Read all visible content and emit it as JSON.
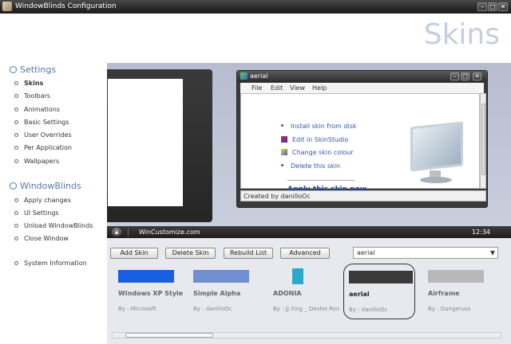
{
  "window": {
    "title": "WindowBlinds Configuration"
  },
  "header": {
    "headline": "Skins"
  },
  "sidebar": {
    "settings_title": "Settings",
    "settings_items": [
      "Skins",
      "Toolbars",
      "Animations",
      "Basic Settings",
      "User Overrides",
      "Per Application",
      "Wallpapers"
    ],
    "wb_title": "WindowBlinds",
    "wb_items": [
      "Apply changes",
      "UI Settings",
      "Unload WindowBlinds",
      "Close Window"
    ],
    "system_info": "System Information"
  },
  "preview": {
    "window_title": "aerial",
    "menu": [
      "File",
      "Edit",
      "View",
      "Help"
    ],
    "links": [
      "Install skin from disk",
      "Edit in SkinStudio",
      "Change skin colour",
      "Delete this skin"
    ],
    "apply": "Apply this skin now",
    "status": "Created by danilloOc",
    "taskbar_label": "WinCustomize.com",
    "clock": "12:34"
  },
  "toolbar": {
    "add": "Add Skin",
    "delete": "Delete Skin",
    "rebuild": "Rebuild List",
    "advanced": "Advanced",
    "selected_skin": "aerial"
  },
  "gallery": [
    {
      "name": "Windows XP Style",
      "by": "By : Microsoft",
      "color": "#1a5fe0"
    },
    {
      "name": "Simple Alpha",
      "by": "By : danilloOc",
      "color": "#6f8fd0"
    },
    {
      "name": "ADONIA",
      "by": "By : JJ.Ying _ Dexter.Ren",
      "color": "#2aa9c9"
    },
    {
      "name": "aerial",
      "by": "By : danilloOc",
      "color": "#3a3a3a"
    },
    {
      "name": "Airframe",
      "by": "By : Dangeruss",
      "color": "#b8b8b8"
    }
  ],
  "colors": {
    "accent": "#5577aa",
    "link": "#3355aa"
  }
}
